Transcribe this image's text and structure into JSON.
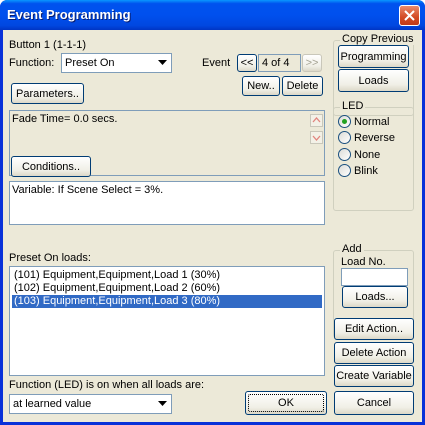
{
  "window": {
    "title": "Event Programming"
  },
  "header": {
    "button_label": "Button 1  (1-1-1)"
  },
  "function": {
    "label": "Function:",
    "value": "Preset On"
  },
  "event": {
    "label": "Event",
    "prev": "<<",
    "next": ">>",
    "counter": "4 of 4",
    "new_label": "New..",
    "delete_label": "Delete"
  },
  "copy_previous": {
    "title": "Copy Previous",
    "programming": "Programming",
    "loads": "Loads"
  },
  "parameters": {
    "button": "Parameters..",
    "text": "Fade Time= 0.0 secs."
  },
  "led": {
    "title": "LED",
    "options": [
      "Normal",
      "Reverse",
      "None",
      "Blink"
    ],
    "selected": "Normal"
  },
  "conditions": {
    "button": "Conditions..",
    "text": "Variable: If Scene Select = 3%."
  },
  "loads": {
    "label": "Preset On loads:",
    "items": [
      "(101) Equipment,Equipment,Load 1 (30%)",
      "(102) Equipment,Equipment,Load 2 (60%)",
      "(103) Equipment,Equipment,Load 3 (80%)"
    ],
    "selected_index": 2
  },
  "add": {
    "title": "Add",
    "load_no_label": "Load No.",
    "load_no_value": "",
    "loads_button": "Loads..."
  },
  "actions": {
    "edit": "Edit Action..",
    "delete": "Delete Action",
    "create": "Create Variable"
  },
  "led_condition": {
    "label": "Function (LED) is on when all loads are:",
    "value": "at learned value"
  },
  "footer": {
    "ok": "OK",
    "cancel": "Cancel"
  },
  "colors": {
    "title_bar": "#0053ee",
    "face": "#ece9d8",
    "selection": "#316ac5",
    "close": "#d34a24"
  }
}
